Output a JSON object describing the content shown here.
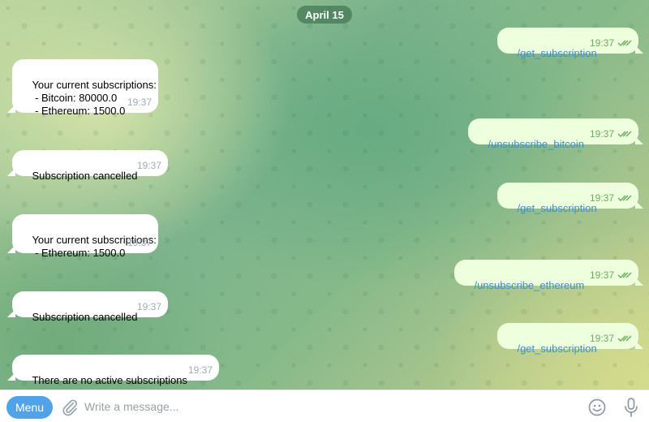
{
  "chat": {
    "date": "April 15",
    "messages": [
      {
        "dir": "out",
        "text": "/get_subscription",
        "time": "19:37"
      },
      {
        "dir": "in",
        "text": "Your current subscriptions:\n - Bitcoin: 80000.0\n - Ethereum: 1500.0",
        "time": "19:37"
      },
      {
        "dir": "out",
        "text": "/unsubscribe_bitcoin",
        "time": "19:37"
      },
      {
        "dir": "in",
        "text": "Subscription cancelled",
        "time": "19:37"
      },
      {
        "dir": "out",
        "text": "/get_subscription",
        "time": "19:37"
      },
      {
        "dir": "in",
        "text": "Your current subscriptions:\n - Ethereum: 1500.0",
        "time": "19:37"
      },
      {
        "dir": "out",
        "text": "/unsubscribe_ethereum",
        "time": "19:37"
      },
      {
        "dir": "in",
        "text": "Subscription cancelled",
        "time": "19:37"
      },
      {
        "dir": "out",
        "text": "/get_subscription",
        "time": "19:37"
      },
      {
        "dir": "in",
        "text": "There are no active subscriptions",
        "time": "19:37"
      }
    ]
  },
  "composer": {
    "menu_label": "Menu",
    "placeholder": "Write a message...",
    "value": ""
  },
  "icons": {
    "attach": "paperclip-icon",
    "emoji": "smiley-icon",
    "mic": "microphone-icon",
    "read_status": "double-check-icon"
  },
  "colors": {
    "accent": "#50a2e9",
    "outgoing_bubble": "#eeffde",
    "incoming_bubble": "#ffffff",
    "command_link": "#3a8fd0",
    "read_check": "#6aae60"
  }
}
